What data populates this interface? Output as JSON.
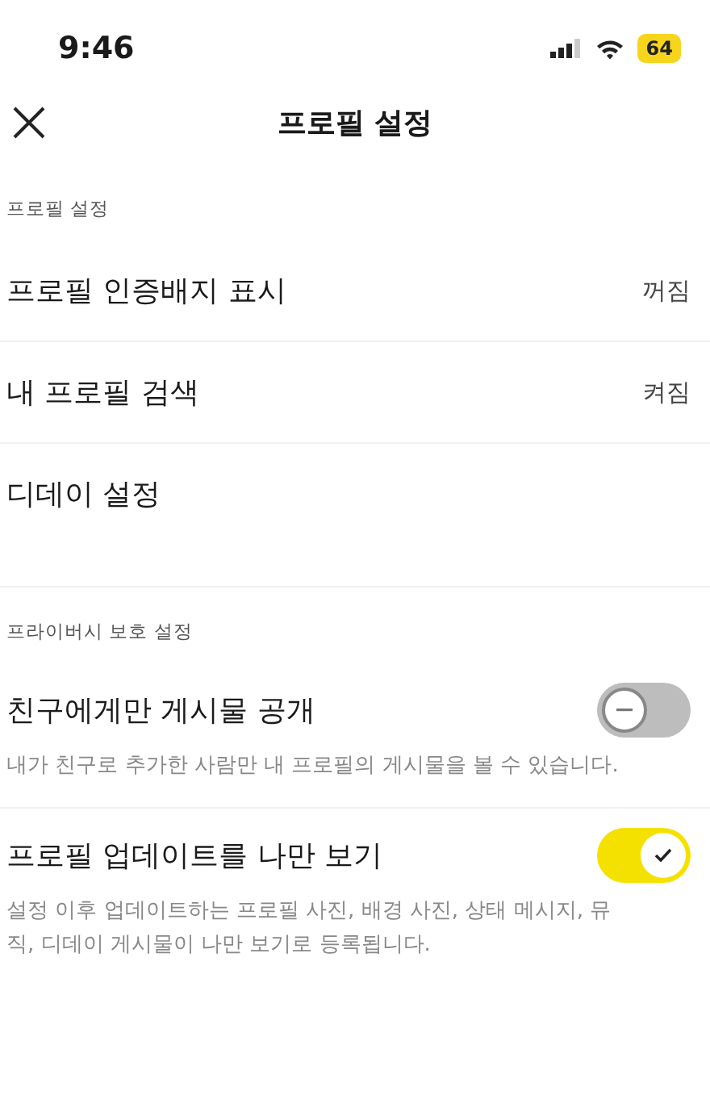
{
  "status_bar": {
    "time": "9:46",
    "battery": "64"
  },
  "header": {
    "title": "프로필 설정"
  },
  "sections": [
    {
      "title": "프로필 설정",
      "items": [
        {
          "kind": "value",
          "label": "프로필 인증배지 표시",
          "value": "꺼짐"
        },
        {
          "kind": "value",
          "label": "내 프로필 검색",
          "value": "켜짐"
        },
        {
          "kind": "link",
          "label": "디데이 설정"
        }
      ]
    },
    {
      "title": "프라이버시 보호 설정",
      "items": [
        {
          "kind": "switch",
          "label": "친구에게만 게시물 공개",
          "on": false,
          "description": "내가 친구로 추가한 사람만 내 프로필의 게시물을 볼 수 있습니다."
        },
        {
          "kind": "switch",
          "label": "프로필 업데이트를 나만 보기",
          "on": true,
          "description": "설정 이후 업데이트하는 프로필 사진, 배경 사진, 상태 메시지, 뮤직, 디데이 게시물이 나만 보기로 등록됩니다."
        }
      ]
    }
  ]
}
